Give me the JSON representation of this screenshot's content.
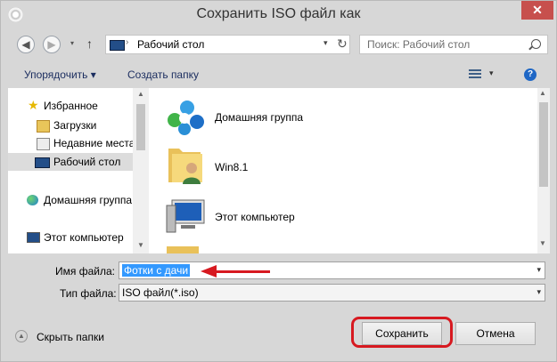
{
  "window": {
    "title": "Сохранить ISO файл как",
    "close_label": "✕"
  },
  "nav": {
    "address": "Рабочий стол",
    "search_placeholder": "Поиск: Рабочий стол"
  },
  "toolbar": {
    "organize_label": "Упорядочить ▾",
    "new_folder_label": "Создать папку",
    "help_label": "?"
  },
  "sidebar": {
    "items": [
      {
        "label": "Избранное"
      },
      {
        "label": "Загрузки"
      },
      {
        "label": "Недавние места"
      },
      {
        "label": "Рабочий стол",
        "selected": true
      },
      {
        "label": "Домашняя группа"
      },
      {
        "label": "Этот компьютер"
      }
    ]
  },
  "content": {
    "items": [
      {
        "label": "Домашняя группа"
      },
      {
        "label": "Win8.1"
      },
      {
        "label": "Этот компьютер"
      }
    ]
  },
  "form": {
    "filename_label": "Имя файла:",
    "filename_value": "Фотки с дачи",
    "filetype_label": "Тип файла:",
    "filetype_value": "ISO файл(*.iso)"
  },
  "footer": {
    "hide_folders_label": "Скрыть папки",
    "save_label": "Сохранить",
    "cancel_label": "Отмена"
  },
  "colors": {
    "highlight": "#d71920",
    "selection": "#3399ff"
  }
}
